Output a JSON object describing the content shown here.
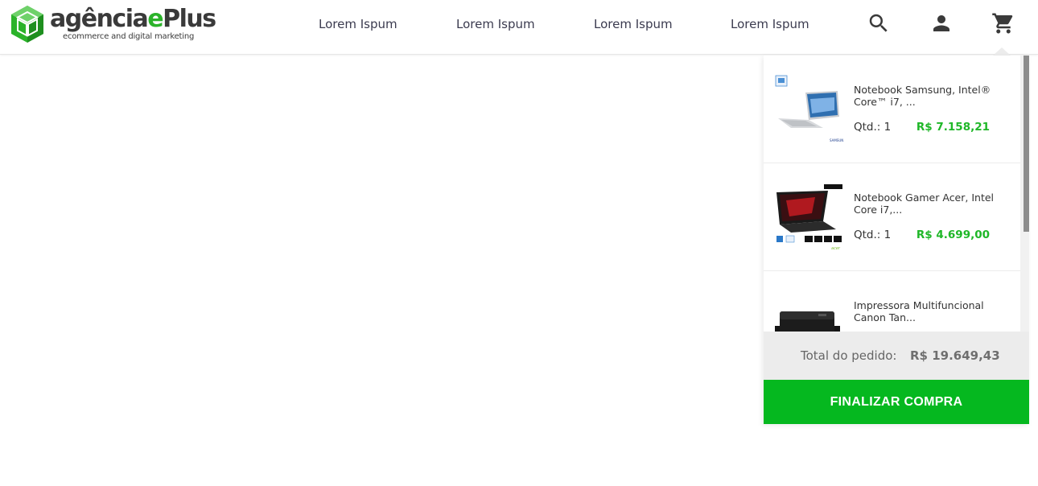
{
  "brand": {
    "name_prefix": "agência",
    "name_e": "e",
    "name_suffix": "Plus",
    "tagline": "ecommerce and digital marketing",
    "logo_icon": "green-cube-logo",
    "accent_color": "#2bb32a"
  },
  "nav": {
    "items": [
      {
        "label": "Lorem Ispum"
      },
      {
        "label": "Lorem Ispum"
      },
      {
        "label": "Lorem Ispum"
      },
      {
        "label": "Lorem Ispum"
      }
    ]
  },
  "header_icons": {
    "search": "search-icon",
    "account": "person-icon",
    "cart": "shopping-cart-icon"
  },
  "cart": {
    "items": [
      {
        "name": "Notebook Samsung, Intel® Core™ i7, ...",
        "qty": "Qtd.: 1",
        "price": "R$ 7.158,21",
        "thumb": "samsung-notebook-thumbnail"
      },
      {
        "name": "Notebook Gamer Acer, Intel Core i7,...",
        "qty": "Qtd.: 1",
        "price": "R$ 4.699,00",
        "thumb": "acer-gamer-notebook-thumbnail"
      },
      {
        "name": "Impressora Multifuncional Canon Tan...",
        "thumb": "canon-printer-thumbnail"
      }
    ],
    "total_label": "Total do pedido:",
    "total_value": "R$ 19.649,43",
    "checkout_label": "FINALIZAR COMPRA",
    "price_color": "#1fb728",
    "checkout_color": "#05b81f"
  }
}
